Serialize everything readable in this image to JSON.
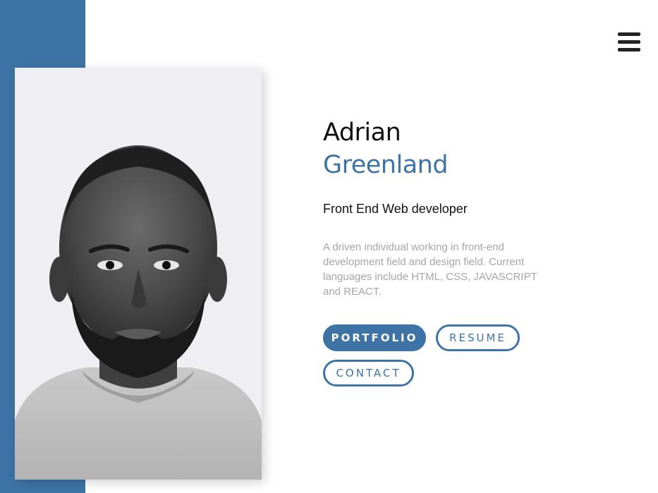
{
  "menu": {
    "icon": "hamburger-menu-icon"
  },
  "profile": {
    "first_name": "Adrian",
    "last_name": "Greenland",
    "role": "Front End Web developer",
    "bio": "A driven individual working in front-end development field and design field. Current languages include HTML, CSS, JAVASCRIPT and REACT.",
    "photo": "portrait-photo"
  },
  "buttons": {
    "portfolio": "PORTFOLIO",
    "resume": "RESUME",
    "contact": "CONTACT"
  },
  "colors": {
    "accent": "#3d74a5",
    "text_dark": "#111111",
    "text_muted": "#a4a6a9",
    "photo_bg": "#efeef2"
  }
}
